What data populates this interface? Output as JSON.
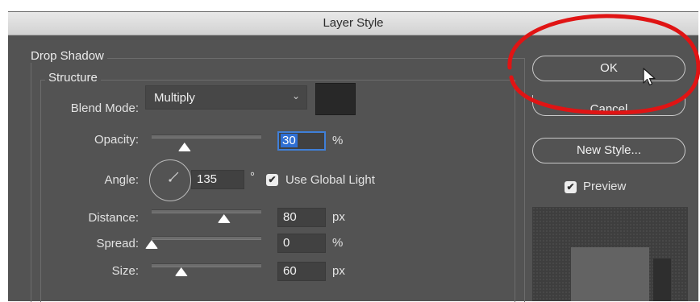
{
  "window": {
    "title": "Layer Style"
  },
  "sections": {
    "drop_shadow": "Drop Shadow",
    "structure": "Structure"
  },
  "blend_mode": {
    "label": "Blend Mode:",
    "value": "Multiply",
    "swatch_color": "#282828"
  },
  "opacity": {
    "label": "Opacity:",
    "value": "30",
    "unit": "%",
    "slider_fraction": 0.3
  },
  "angle": {
    "label": "Angle:",
    "value": "135",
    "unit": "°",
    "degrees": 135,
    "use_global_light": "Use Global Light"
  },
  "distance": {
    "label": "Distance:",
    "value": "80",
    "unit": "px",
    "slider_fraction": 0.66
  },
  "spread": {
    "label": "Spread:",
    "value": "0",
    "unit": "%",
    "slider_fraction": 0.0
  },
  "size": {
    "label": "Size:",
    "value": "60",
    "unit": "px",
    "slider_fraction": 0.27
  },
  "buttons": {
    "ok": "OK",
    "cancel": "Cancel",
    "new_style": "New Style..."
  },
  "preview": {
    "label": "Preview"
  },
  "colors": {
    "highlight_circle": "#e01414",
    "selection": "#2f6fd3",
    "dialog_bg": "#535353"
  }
}
